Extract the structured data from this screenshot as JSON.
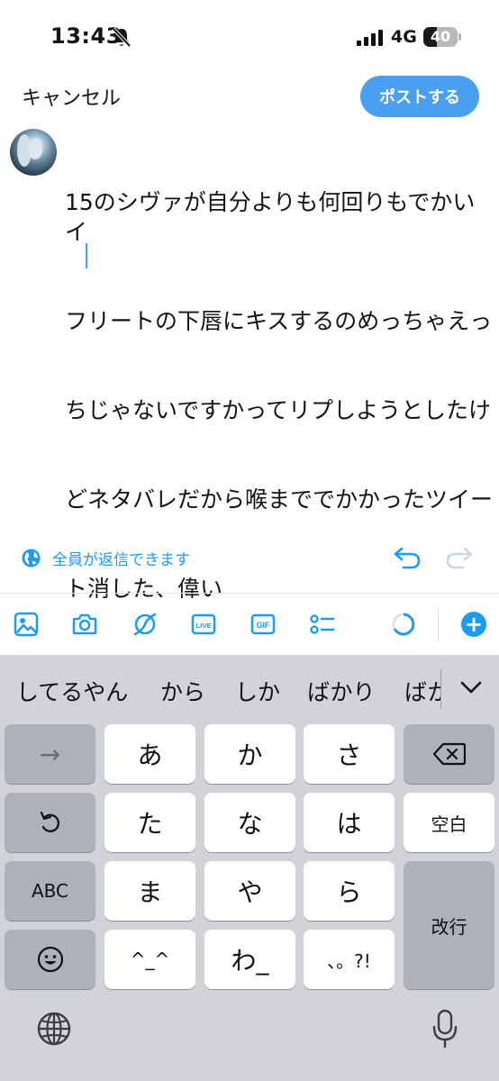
{
  "status_bar": {
    "time": "13:43",
    "network": "4G",
    "battery": "40",
    "battery_level": 0.4,
    "icons": [
      "bell-slash-icon",
      "signal-bars-icon",
      "battery-icon"
    ]
  },
  "header": {
    "cancel_label": "キャンセル",
    "post_label": "ポストする",
    "accent_color": "#4a9ff0"
  },
  "compose": {
    "text": "15のシヴァが自分よりも何回りもでかいイフリートの下唇にキスするのめっちゃえっちじゃないですかってリプしようとしたけどネタバレだから喉まででかかったツイート消した、偉い",
    "lines": [
      "15のシヴァが自分よりも何回りもでかいイ",
      "フリートの下唇にキスするのめっちゃえっ",
      "ちじゃないですかってリプしようとしたけ",
      "どネタバレだから喉まででかかったツイー",
      "ト消した、偉い"
    ]
  },
  "reply_settings": {
    "label": "全員が返信できます",
    "icon": "globe-icon"
  },
  "toolbar": {
    "items": [
      "image-icon",
      "camera-icon",
      "scribble-icon",
      "live-icon",
      "gif-icon",
      "poll-icon",
      "progress-ring-icon",
      "add-icon"
    ],
    "live_label": "LIVE",
    "gif_label": "GIF",
    "plus_label": "+"
  },
  "keyboard": {
    "suggestions": [
      "してるやん",
      "から",
      "しか",
      "ばかり",
      "ばか"
    ],
    "rows": [
      [
        "→",
        "あ",
        "か",
        "さ",
        "⌫"
      ],
      [
        "↺",
        "た",
        "な",
        "は",
        "空白"
      ],
      [
        "ABC",
        "ま",
        "や",
        "ら",
        "改行"
      ],
      [
        "☺",
        "^_^",
        "わ_",
        "、。?!"
      ]
    ],
    "arrow": "→",
    "a": "あ",
    "ka": "か",
    "sa": "さ",
    "ta": "た",
    "na": "な",
    "ha": "は",
    "space": "空白",
    "abc": "ABC",
    "ma": "ま",
    "ya": "や",
    "ra": "ら",
    "return": "改行",
    "kaomoji": "^_^",
    "wa": "わ_",
    "punct": "、。?!"
  }
}
